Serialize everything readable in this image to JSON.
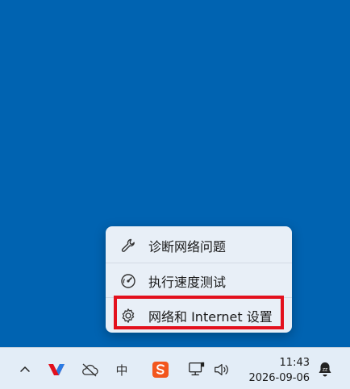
{
  "menu": {
    "items": [
      {
        "label": "诊断网络问题",
        "icon": "wrench-icon"
      },
      {
        "label": "执行速度测试",
        "icon": "speedometer-icon"
      },
      {
        "label": "网络和 Internet 设置",
        "icon": "gear-icon"
      }
    ],
    "highlight_color": "#e3101d"
  },
  "taskbar": {
    "ime_label": "中",
    "time": "11:43",
    "date": "2026-09-06",
    "tray_icons": [
      "chevron-up-icon",
      "vpn-app-icon",
      "cloud-offline-icon",
      "ime-icon",
      "sogou-input-icon",
      "network-icon",
      "volume-icon",
      "notification-icon"
    ]
  },
  "colors": {
    "desktop": "#0063b1",
    "taskbar": "#e3edf7",
    "menu": "#e8eff7"
  }
}
